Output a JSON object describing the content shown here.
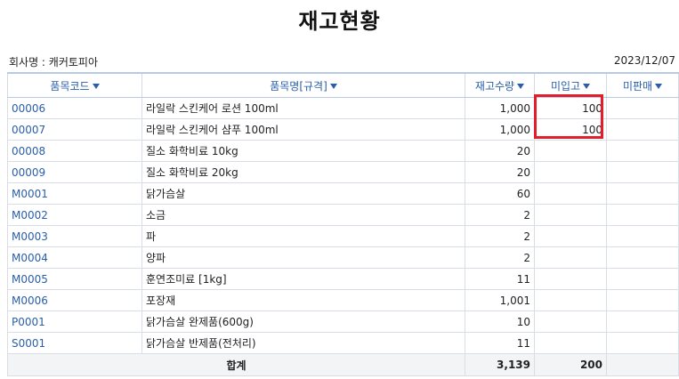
{
  "page": {
    "title": "재고현황",
    "company_label": "회사명 : 캐커토피아",
    "date": "2023/12/07"
  },
  "table": {
    "headers": {
      "code": "품목코드",
      "name": "품목명[규격]",
      "stock": "재고수량",
      "not_received": "미입고",
      "not_sold": "미판매"
    },
    "rows": [
      {
        "code": "00006",
        "name": "라일락 스킨케어 로션 100ml",
        "stock": "1,000",
        "not_received": "100",
        "not_sold": ""
      },
      {
        "code": "00007",
        "name": "라일락 스킨케어 샴푸 100ml",
        "stock": "1,000",
        "not_received": "100",
        "not_sold": ""
      },
      {
        "code": "00008",
        "name": "질소 화학비료 10kg",
        "stock": "20",
        "not_received": "",
        "not_sold": ""
      },
      {
        "code": "00009",
        "name": "질소 화학비료 20kg",
        "stock": "20",
        "not_received": "",
        "not_sold": ""
      },
      {
        "code": "M0001",
        "name": "닭가슴살",
        "stock": "60",
        "not_received": "",
        "not_sold": ""
      },
      {
        "code": "M0002",
        "name": "소금",
        "stock": "2",
        "not_received": "",
        "not_sold": ""
      },
      {
        "code": "M0003",
        "name": "파",
        "stock": "2",
        "not_received": "",
        "not_sold": ""
      },
      {
        "code": "M0004",
        "name": "양파",
        "stock": "2",
        "not_received": "",
        "not_sold": ""
      },
      {
        "code": "M0005",
        "name": "훈연조미료 [1kg]",
        "stock": "11",
        "not_received": "",
        "not_sold": ""
      },
      {
        "code": "M0006",
        "name": "포장재",
        "stock": "1,001",
        "not_received": "",
        "not_sold": ""
      },
      {
        "code": "P0001",
        "name": "닭가슴살 완제품(600g)",
        "stock": "10",
        "not_received": "",
        "not_sold": ""
      },
      {
        "code": "S0001",
        "name": "닭가슴살 반제품(전처리)",
        "stock": "11",
        "not_received": "",
        "not_sold": ""
      }
    ],
    "total": {
      "label": "합계",
      "stock": "3,139",
      "not_received": "200",
      "not_sold": ""
    }
  },
  "colors": {
    "header_text": "#2a5ea8",
    "highlight": "#e11e2a"
  }
}
